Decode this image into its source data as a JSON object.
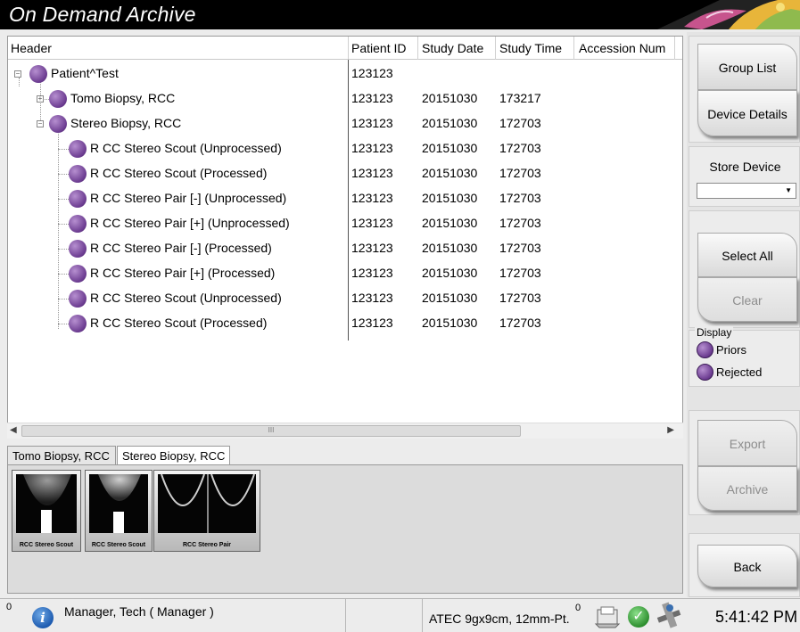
{
  "window": {
    "title": "On Demand Archive"
  },
  "table": {
    "columns": [
      "Header",
      "Patient ID",
      "Study Date",
      "Study Time",
      "Accession Num"
    ],
    "rows": [
      {
        "label": "Patient^Test",
        "patient_id": "123123",
        "study_date": "",
        "study_time": "",
        "accession": ""
      },
      {
        "label": "Tomo Biopsy, RCC",
        "patient_id": "123123",
        "study_date": "20151030",
        "study_time": "173217",
        "accession": ""
      },
      {
        "label": "Stereo Biopsy, RCC",
        "patient_id": "123123",
        "study_date": "20151030",
        "study_time": "172703",
        "accession": ""
      },
      {
        "label": "R CC Stereo Scout   (Unprocessed)",
        "patient_id": "123123",
        "study_date": "20151030",
        "study_time": "172703",
        "accession": ""
      },
      {
        "label": "R CC Stereo Scout   (Processed)",
        "patient_id": "123123",
        "study_date": "20151030",
        "study_time": "172703",
        "accession": ""
      },
      {
        "label": "R CC Stereo Pair [-]  (Unprocessed)",
        "patient_id": "123123",
        "study_date": "20151030",
        "study_time": "172703",
        "accession": ""
      },
      {
        "label": "R CC Stereo Pair [+]  (Unprocessed)",
        "patient_id": "123123",
        "study_date": "20151030",
        "study_time": "172703",
        "accession": ""
      },
      {
        "label": "R CC Stereo Pair [-]  (Processed)",
        "patient_id": "123123",
        "study_date": "20151030",
        "study_time": "172703",
        "accession": ""
      },
      {
        "label": "R CC Stereo Pair [+]  (Processed)",
        "patient_id": "123123",
        "study_date": "20151030",
        "study_time": "172703",
        "accession": ""
      },
      {
        "label": "R CC Stereo Scout   (Unprocessed)",
        "patient_id": "123123",
        "study_date": "20151030",
        "study_time": "172703",
        "accession": ""
      },
      {
        "label": "R CC Stereo Scout   (Processed)",
        "patient_id": "123123",
        "study_date": "20151030",
        "study_time": "172703",
        "accession": ""
      }
    ]
  },
  "scrollbar": {
    "grip": "III"
  },
  "tabs": [
    {
      "label": "Tomo Biopsy, RCC"
    },
    {
      "label": "Stereo Biopsy, RCC"
    }
  ],
  "thumbnails": [
    {
      "label": "RCC Stereo Scout"
    },
    {
      "label": "RCC Stereo Scout"
    },
    {
      "label": "RCC Stereo Pair"
    }
  ],
  "sidebar": {
    "group_list": "Group List",
    "device_details": "Device Details",
    "store_device_label": "Store Device",
    "store_device_value": "",
    "select_all": "Select All",
    "clear": "Clear",
    "display_label": "Display",
    "display_items": [
      "Priors",
      "Rejected"
    ],
    "export": "Export",
    "archive": "Archive",
    "back": "Back"
  },
  "status": {
    "left_count": "0",
    "user": "Manager, Tech ( Manager )",
    "paddle": "ATEC 9gx9cm, 12mm-Pt.",
    "right_count": "0",
    "time": "5:41:42 PM"
  },
  "colors": {
    "titlebar": "#000000",
    "study_dot": "#6a3a8f",
    "info": "#1d5bb0",
    "ok": "#2e8f2f"
  }
}
